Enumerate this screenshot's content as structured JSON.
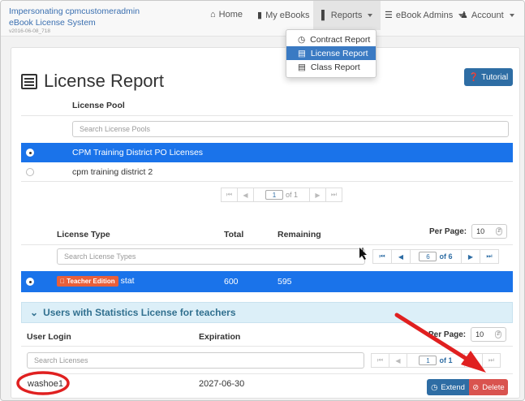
{
  "header": {
    "impersonating": "Impersonating cpmcustomeradmin",
    "system": "eBook License System",
    "version": "v2016-06-08_718"
  },
  "nav": {
    "home": "Home",
    "my_ebooks": "My eBooks",
    "reports": "Reports",
    "ebook_admins": "eBook Admins",
    "account": "Account"
  },
  "dropdown": {
    "items": [
      "Contract Report",
      "License Report",
      "Class Report"
    ],
    "selected": "License Report"
  },
  "page": {
    "title": "License Report",
    "tutorial": "Tutorial"
  },
  "pools": {
    "header": "License Pool",
    "search_placeholder": "Search License Pools",
    "rows": [
      "CPM Training District PO Licenses",
      "cpm training district 2"
    ],
    "pager": {
      "page": "1",
      "of": "of 1"
    }
  },
  "types": {
    "col_type": "License Type",
    "col_total": "Total",
    "col_remaining": "Remaining",
    "per_page_label": "Per Page:",
    "per_page_value": "10",
    "search_placeholder": "Search License Types",
    "pager": {
      "page": "6",
      "of": "of 6"
    },
    "row": {
      "badge": "Teacher Edition",
      "name": "stat",
      "total": "600",
      "remaining": "595"
    }
  },
  "users": {
    "section_title": "Users with Statistics License for teachers",
    "col_login": "User Login",
    "col_expiration": "Expiration",
    "per_page_label": "Per Page:",
    "per_page_value": "10",
    "search_placeholder": "Search Licenses",
    "pager": {
      "page": "1",
      "of": "of 1"
    },
    "row": {
      "login": "washoe1",
      "expiration": "2027-06-30",
      "extend": "Extend",
      "delete": "Delete"
    }
  },
  "colors": {
    "selected_row": "#1a73ea",
    "primary": "#2e6da4",
    "danger": "#d9534f",
    "annotation": "#e02020"
  }
}
